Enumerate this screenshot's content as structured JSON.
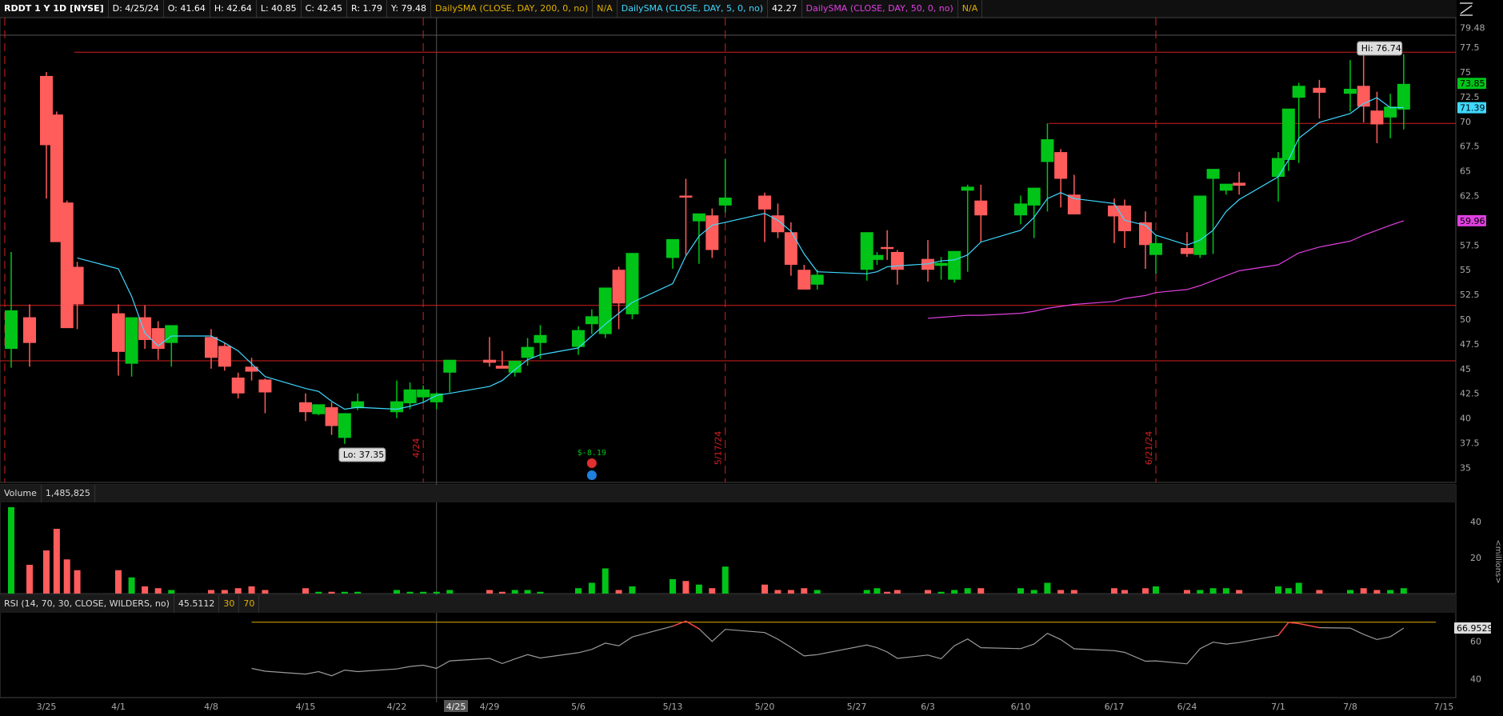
{
  "header": {
    "symbol": "RDDT 1 Y 1D [NYSE]",
    "date": "D: 4/25/24",
    "open": "O: 41.64",
    "high": "H: 42.64",
    "low": "L: 40.85",
    "close": "C: 42.45",
    "range": "R: 1.79",
    "y": "Y: 79.48",
    "sma200_label": "DailySMA (CLOSE, DAY, 200, 0, no)",
    "sma200_value": "N/A",
    "sma5_label": "DailySMA (CLOSE, DAY, 5, 0, no)",
    "sma5_value": "42.27",
    "sma50_label": "DailySMA (CLOSE, DAY, 50, 0, no)",
    "sma50_value": "N/A"
  },
  "price_panel": {
    "y_ticks": [
      "77.5",
      "75",
      "72.5",
      "70",
      "67.5",
      "65",
      "62.5",
      "60",
      "57.5",
      "55",
      "52.5",
      "50",
      "47.5",
      "45",
      "42.5",
      "40",
      "37.5",
      "35"
    ],
    "top_label": "79.48",
    "last_price_tag": "73.85",
    "sma5_tag": "71.39",
    "sma50_tag": "59.96",
    "hi_label": "Hi: 76.74",
    "lo_label": "Lo: 37.35",
    "event_marker": "$-8.19",
    "vline_labels": [
      "4/24",
      "5/17/24",
      "6/21/24"
    ]
  },
  "volume_panel": {
    "title": "Volume",
    "value": "1,485,825",
    "y_ticks": [
      "40",
      "20"
    ],
    "unit": "<millions>"
  },
  "rsi_panel": {
    "title": "RSI (14, 70, 30, CLOSE, WILDERS, no)",
    "value": "45.5112",
    "level_low": "30",
    "level_high": "70",
    "y_ticks": [
      "60",
      "40"
    ],
    "tag": "66.9529"
  },
  "x_axis": {
    "labels": [
      "3/25",
      "4/1",
      "4/8",
      "4/15",
      "4/22",
      "4/25",
      "4/29",
      "5/6",
      "5/13",
      "5/20",
      "5/27",
      "6/3",
      "6/10",
      "6/17",
      "6/24",
      "7/1",
      "7/8",
      "7/15"
    ],
    "cursor_label": "4/25"
  },
  "chart_data": {
    "type": "candlestick",
    "dates": [
      "3/21",
      "3/22",
      "3/25",
      "3/26",
      "3/27",
      "3/28",
      "4/1",
      "4/2",
      "4/3",
      "4/4",
      "4/5",
      "4/8",
      "4/9",
      "4/10",
      "4/11",
      "4/12",
      "4/15",
      "4/16",
      "4/17",
      "4/18",
      "4/19",
      "4/22",
      "4/23",
      "4/24",
      "4/25",
      "4/26",
      "4/29",
      "4/30",
      "5/1",
      "5/2",
      "5/3",
      "5/6",
      "5/7",
      "5/8",
      "5/9",
      "5/10",
      "5/13",
      "5/14",
      "5/15",
      "5/16",
      "5/17",
      "5/20",
      "5/21",
      "5/22",
      "5/23",
      "5/24",
      "5/28",
      "5/29",
      "5/30",
      "5/31",
      "6/3",
      "6/4",
      "6/5",
      "6/6",
      "6/7",
      "6/10",
      "6/11",
      "6/12",
      "6/13",
      "6/14",
      "6/17",
      "6/18",
      "6/20",
      "6/21",
      "6/24",
      "6/25",
      "6/26",
      "6/27",
      "6/28",
      "7/1",
      "7/2",
      "7/3",
      "7/5",
      "7/8",
      "7/9",
      "7/10",
      "7/11",
      "7/12"
    ],
    "open": [
      47.0,
      50.2,
      74.6,
      70.7,
      61.8,
      55.3,
      50.6,
      45.5,
      50.2,
      49.1,
      47.6,
      48.2,
      47.3,
      44.1,
      45.2,
      43.9,
      41.6,
      40.4,
      41.1,
      38.0,
      41.0,
      40.6,
      41.5,
      42.1,
      41.6,
      44.6,
      45.9,
      45.3,
      44.6,
      46.1,
      47.6,
      47.2,
      49.5,
      48.5,
      55.0,
      50.5,
      56.2,
      62.5,
      59.9,
      60.5,
      61.5,
      62.5,
      60.5,
      58.8,
      55.0,
      53.5,
      55.0,
      56.0,
      57.3,
      56.8,
      56.1,
      55.4,
      54.0,
      63.0,
      62.0,
      60.5,
      61.5,
      65.9,
      66.9,
      62.6,
      61.5,
      61.5,
      59.8,
      56.5,
      57.2,
      56.5,
      64.2,
      63.0,
      63.8,
      64.4,
      66.1,
      72.4,
      73.4,
      72.8,
      73.6,
      71.1,
      70.4,
      71.2
    ],
    "high": [
      56.8,
      51.5,
      75.0,
      71.0,
      62.0,
      55.8,
      51.5,
      45.9,
      51.4,
      49.8,
      48.0,
      49.0,
      47.6,
      44.6,
      46.1,
      44.0,
      42.5,
      41.1,
      41.6,
      39.3,
      42.5,
      43.8,
      43.6,
      43.3,
      42.6,
      45.8,
      48.2,
      46.8,
      45.8,
      48.1,
      49.4,
      49.3,
      51.0,
      50.2,
      55.3,
      52.4,
      56.9,
      64.2,
      60.6,
      61.2,
      66.2,
      62.8,
      61.7,
      59.8,
      55.5,
      55.0,
      57.9,
      56.8,
      59.0,
      57.0,
      58.0,
      56.3,
      55.8,
      63.6,
      63.6,
      62.5,
      62.1,
      69.8,
      67.2,
      64.6,
      62.2,
      62.1,
      60.9,
      58.5,
      58.8,
      58.6,
      64.4,
      63.7,
      64.9,
      66.9,
      66.9,
      73.9,
      74.2,
      76.2,
      76.7,
      73.0,
      72.8,
      76.8
    ],
    "low": [
      45.1,
      45.2,
      62.2,
      62.3,
      55.3,
      49.0,
      44.3,
      44.2,
      47.0,
      45.9,
      45.2,
      45.0,
      44.8,
      42.0,
      43.8,
      40.5,
      39.7,
      40.3,
      38.3,
      37.4,
      40.8,
      40.0,
      40.9,
      41.6,
      40.9,
      42.6,
      45.2,
      45.1,
      44.2,
      45.3,
      46.0,
      46.4,
      48.5,
      48.1,
      49.0,
      50.0,
      55.1,
      56.5,
      55.6,
      56.2,
      60.8,
      57.8,
      58.2,
      54.4,
      53.1,
      53.0,
      53.9,
      55.5,
      56.0,
      53.5,
      53.8,
      54.0,
      53.7,
      54.8,
      57.8,
      59.6,
      58.2,
      60.9,
      61.3,
      62.1,
      57.7,
      57.2,
      55.1,
      54.6,
      56.3,
      56.2,
      56.6,
      62.6,
      62.6,
      61.9,
      65.0,
      65.8,
      70.3,
      71.0,
      69.9,
      67.8,
      68.3,
      69.2
    ],
    "close": [
      50.9,
      47.6,
      67.6,
      57.8,
      49.1,
      51.5,
      46.7,
      50.2,
      47.9,
      47.0,
      49.4,
      46.1,
      45.2,
      42.5,
      44.7,
      42.6,
      40.6,
      41.4,
      39.2,
      40.5,
      41.7,
      41.7,
      42.9,
      42.9,
      42.5,
      45.9,
      45.6,
      45.0,
      45.8,
      47.2,
      48.4,
      48.9,
      50.3,
      53.2,
      51.6,
      56.7,
      58.1,
      62.3,
      60.7,
      57.0,
      62.3,
      61.1,
      58.8,
      55.5,
      53.0,
      54.5,
      58.8,
      56.5,
      57.1,
      55.0,
      55.0,
      55.7,
      56.9,
      63.4,
      60.5,
      61.7,
      63.3,
      68.2,
      64.2,
      60.6,
      60.4,
      58.9,
      57.5,
      57.7,
      56.6,
      62.5,
      65.2,
      63.7,
      63.5,
      66.3,
      71.3,
      73.6,
      72.9,
      73.3,
      71.5,
      69.7,
      71.5,
      73.8
    ],
    "volume_millions": [
      48,
      16,
      24,
      36,
      19,
      13,
      13,
      9,
      4,
      3,
      2,
      2,
      2,
      3,
      4,
      2,
      3,
      1,
      1,
      1,
      1,
      2,
      1,
      1,
      1,
      2,
      2,
      1,
      2,
      2,
      1,
      3,
      6,
      14,
      2,
      4,
      8,
      7,
      5,
      3,
      15,
      5,
      2,
      2,
      3,
      2,
      2,
      3,
      1,
      2,
      2,
      1,
      2,
      3,
      3,
      3,
      2,
      6,
      2,
      2,
      3,
      2,
      3,
      4,
      2,
      2,
      3,
      3,
      2,
      4,
      3,
      6,
      2,
      2,
      3,
      2,
      2,
      3
    ],
    "rsi": [
      null,
      null,
      null,
      null,
      null,
      null,
      null,
      null,
      null,
      null,
      null,
      null,
      null,
      null,
      45.5,
      44.0,
      42.5,
      43.8,
      41.6,
      44.6,
      43.8,
      45.2,
      46.5,
      47.2,
      45.5,
      49.5,
      50.8,
      48.1,
      50.5,
      52.8,
      51.0,
      53.8,
      55.6,
      58.9,
      57.5,
      62.2,
      67.9,
      70.6,
      66.5,
      59.8,
      66.2,
      64.5,
      61.0,
      56.6,
      52.1,
      52.8,
      57.9,
      56.5,
      54.2,
      50.8,
      52.6,
      50.6,
      57.5,
      61.1,
      56.5,
      56.0,
      58.4,
      64.1,
      60.8,
      55.9,
      54.9,
      54.0,
      49.3,
      49.5,
      47.9,
      56.0,
      59.4,
      58.4,
      59.2,
      63.0,
      69.9,
      69.3,
      67.1,
      66.9,
      63.6,
      60.8,
      62.3,
      66.9
    ],
    "sma5": [
      null,
      null,
      null,
      null,
      null,
      56.2,
      55.1,
      52.3,
      48.6,
      47.3,
      48.3,
      48.3,
      47.6,
      46.8,
      45.5,
      44.2,
      43.0,
      42.7,
      41.7,
      40.9,
      41.1,
      40.9,
      41.2,
      41.6,
      42.3,
      42.5,
      43.2,
      43.8,
      44.9,
      45.9,
      46.4,
      47.1,
      48.3,
      49.5,
      50.6,
      51.7,
      53.6,
      56.4,
      58.4,
      59.5,
      59.8,
      60.7,
      60.0,
      58.9,
      56.6,
      54.8,
      54.6,
      54.8,
      55.3,
      55.4,
      55.6,
      55.9,
      56.0,
      56.5,
      57.8,
      59.0,
      60.3,
      62.2,
      62.8,
      62.2,
      61.7,
      60.0,
      59.5,
      58.5,
      57.5,
      58.0,
      59.0,
      60.9,
      62.1,
      64.4,
      66.1,
      68.3,
      69.9,
      70.8,
      71.8,
      72.4,
      71.4,
      71.4
    ],
    "sma50": [
      null,
      null,
      null,
      null,
      null,
      null,
      null,
      null,
      null,
      null,
      null,
      null,
      null,
      null,
      null,
      null,
      null,
      null,
      null,
      null,
      null,
      null,
      null,
      null,
      null,
      null,
      null,
      null,
      null,
      null,
      null,
      null,
      null,
      null,
      null,
      null,
      null,
      null,
      null,
      null,
      null,
      null,
      null,
      null,
      null,
      null,
      null,
      null,
      null,
      null,
      50.1,
      50.2,
      50.3,
      50.4,
      50.4,
      50.6,
      50.8,
      51.1,
      51.3,
      51.5,
      51.8,
      52.1,
      52.4,
      52.7,
      53.0,
      53.4,
      53.9,
      54.4,
      54.9,
      55.5,
      56.1,
      56.7,
      57.3,
      57.9,
      58.5,
      59.0,
      59.5,
      59.96
    ],
    "horizontal_levels": [
      77.0,
      69.8,
      51.4,
      45.8
    ],
    "ylim_price": [
      33.5,
      80.5
    ],
    "ylim_volume_millions": [
      0,
      48
    ],
    "ylim_rsi": [
      30,
      75
    ]
  },
  "colors": {
    "up": "#00c418",
    "down": "#ff5c5c",
    "sma5": "#3fd8ff",
    "sma50": "#e040e0",
    "level_line": "#d42020",
    "rsi_line": "#9a9a9a",
    "rsi_overbought": "#ff4040"
  }
}
